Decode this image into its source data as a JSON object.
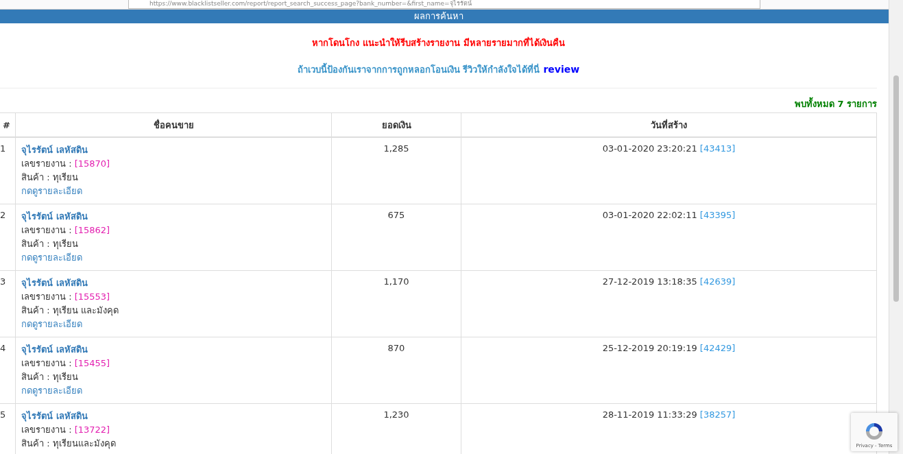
{
  "browser": {
    "url": "https://www.blacklistseller.com/report/report_search_success_page?bank_number=&first_name=จุไรรัตน์"
  },
  "header": {
    "title": "ผลการค้นหา"
  },
  "warning": "หากโดนโกง แนะนำให้รีบสร้างรายงาน มีหลายรายมากที่ได้เงินคืน",
  "review_note": {
    "text": "ถ้าเวบนี้ป้องกันเราจากการถูกหลอกโอนเงิน รีวิวให้กำลังใจได้ที่นี่",
    "link": "review"
  },
  "result_count": "พบทั้งหมด 7 รายการ",
  "table": {
    "columns": [
      "#",
      "ชื่อคนขาย",
      "ยอดเงิน",
      "วันที่สร้าง"
    ],
    "rows": [
      {
        "index": "1",
        "seller": "จุไรรัตน์ เลหัสดิน",
        "report_label": "เลขรายงาน :",
        "report_no": "[15870]",
        "product": "สินค้า : ทุเรียน",
        "detail_link": "กดดูรายละเอียด",
        "amount": "1,285",
        "created": "03-01-2020 23:20:21",
        "report_id": "[43413]"
      },
      {
        "index": "2",
        "seller": "จุไรรัตน์ เลหัสดิน",
        "report_label": "เลขรายงาน :",
        "report_no": "[15862]",
        "product": "สินค้า : ทุเรียน",
        "detail_link": "กดดูรายละเอียด",
        "amount": "675",
        "created": "03-01-2020 22:02:11",
        "report_id": "[43395]"
      },
      {
        "index": "3",
        "seller": "จุไรรัตน์ เลหัสดิน",
        "report_label": "เลขรายงาน :",
        "report_no": "[15553]",
        "product": "สินค้า : ทุเรียน และมังคุด",
        "detail_link": "กดดูรายละเอียด",
        "amount": "1,170",
        "created": "27-12-2019 13:18:35",
        "report_id": "[42639]"
      },
      {
        "index": "4",
        "seller": "จุไรรัตน์ เลหัสดิน",
        "report_label": "เลขรายงาน :",
        "report_no": "[15455]",
        "product": "สินค้า : ทุเรียน",
        "detail_link": "กดดูรายละเอียด",
        "amount": "870",
        "created": "25-12-2019 20:19:19",
        "report_id": "[42429]"
      },
      {
        "index": "5",
        "seller": "จุไรรัตน์ เลหัสดิน",
        "report_label": "เลขรายงาน :",
        "report_no": "[13722]",
        "product": "สินค้า : ทุเรียนและมังคุด",
        "amount": "1,230",
        "created": "28-11-2019 11:33:29",
        "report_id": "[38257]"
      }
    ]
  },
  "recaptcha": {
    "links": "Privacy - Terms"
  }
}
